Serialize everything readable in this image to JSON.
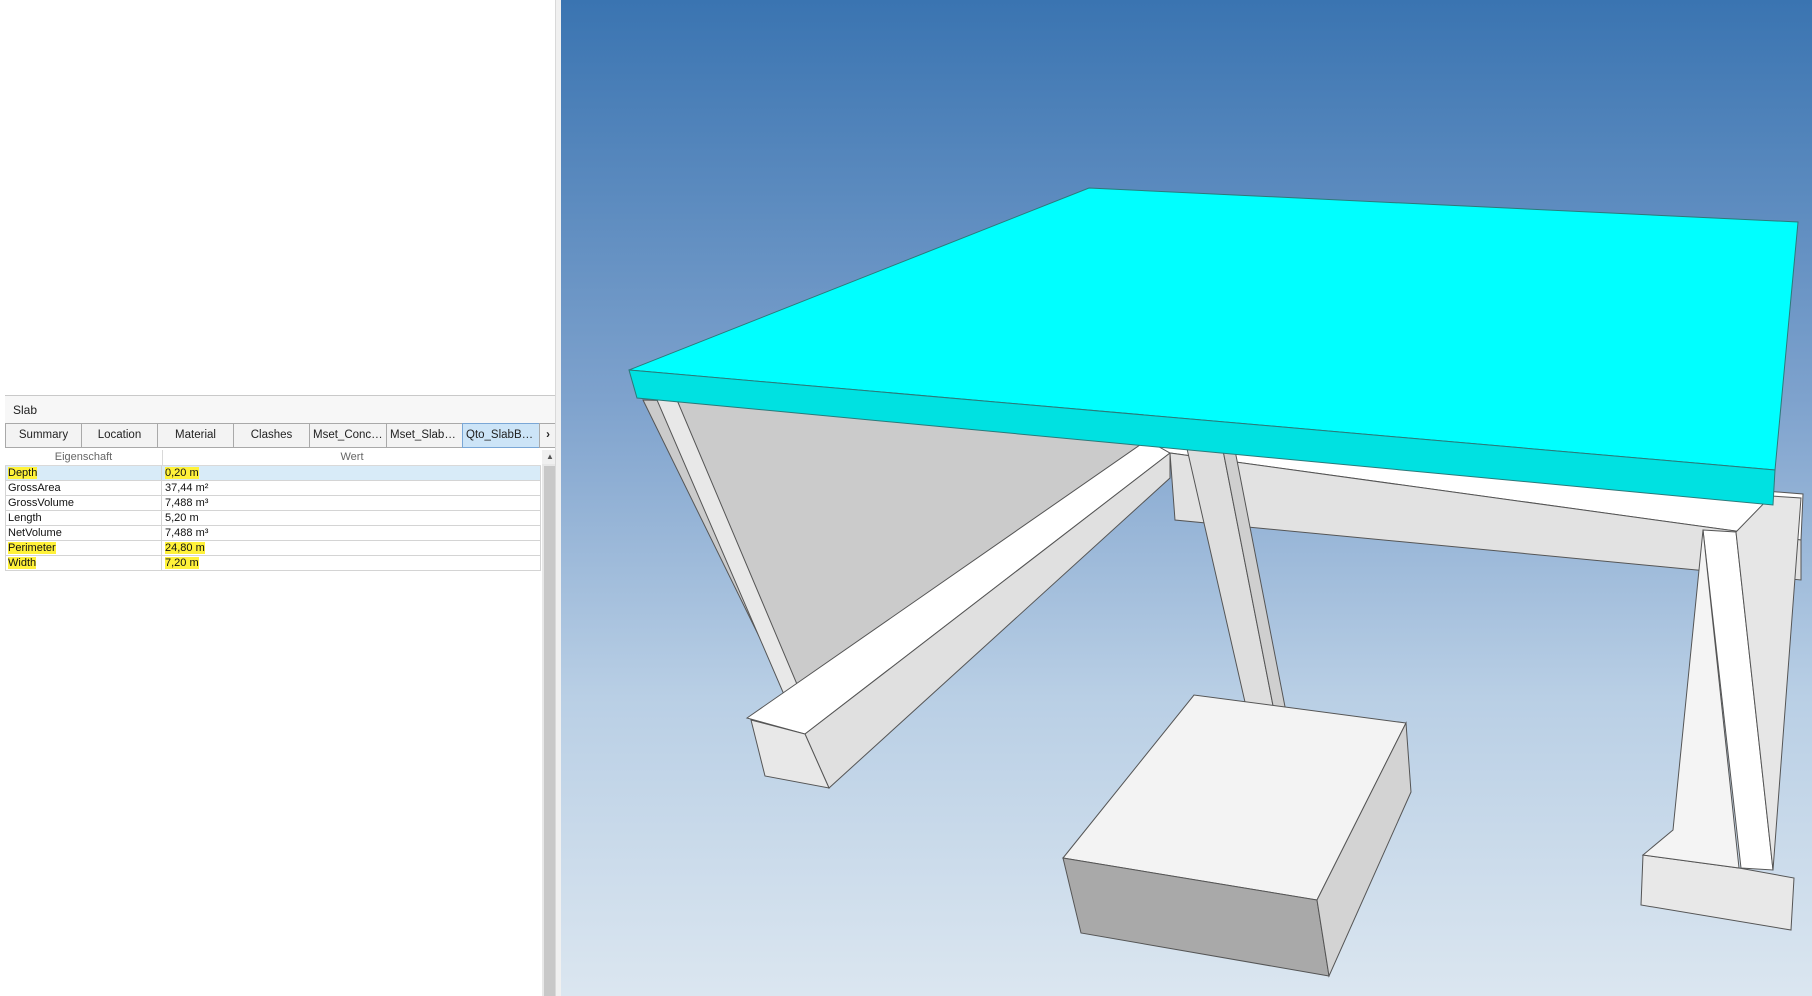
{
  "panel": {
    "title": "Slab",
    "tabs": [
      {
        "label": "Summary",
        "active": false
      },
      {
        "label": "Location",
        "active": false
      },
      {
        "label": "Material",
        "active": false
      },
      {
        "label": "Clashes",
        "active": false
      },
      {
        "label": "Mset_Concr...",
        "active": false
      },
      {
        "label": "Mset_SlabS...",
        "active": false
      },
      {
        "label": "Qto_SlabBas...",
        "active": true
      }
    ],
    "tab_scroll_icon": "chevron-right-icon",
    "columns": {
      "property": "Eigenschaft",
      "value": "Wert"
    },
    "rows": [
      {
        "property": "Depth",
        "value": "0,20 m",
        "highlighted": true,
        "selected": true
      },
      {
        "property": "GrossArea",
        "value": "37,44 m²",
        "highlighted": false,
        "selected": false
      },
      {
        "property": "GrossVolume",
        "value": "7,488 m³",
        "highlighted": false,
        "selected": false
      },
      {
        "property": "Length",
        "value": "5,20 m",
        "highlighted": false,
        "selected": false
      },
      {
        "property": "NetVolume",
        "value": "7,488 m³",
        "highlighted": false,
        "selected": false
      },
      {
        "property": "Perimeter",
        "value": "24,80 m",
        "highlighted": true,
        "selected": false
      },
      {
        "property": "Width",
        "value": "7,20 m",
        "highlighted": true,
        "selected": false
      }
    ]
  },
  "colors": {
    "highlight": "#fff23a",
    "slab_top": "#00ffff",
    "slab_side": "#00e1e1",
    "viewport_top": "#3a74b1",
    "viewport_bottom": "#dbe6f0"
  }
}
